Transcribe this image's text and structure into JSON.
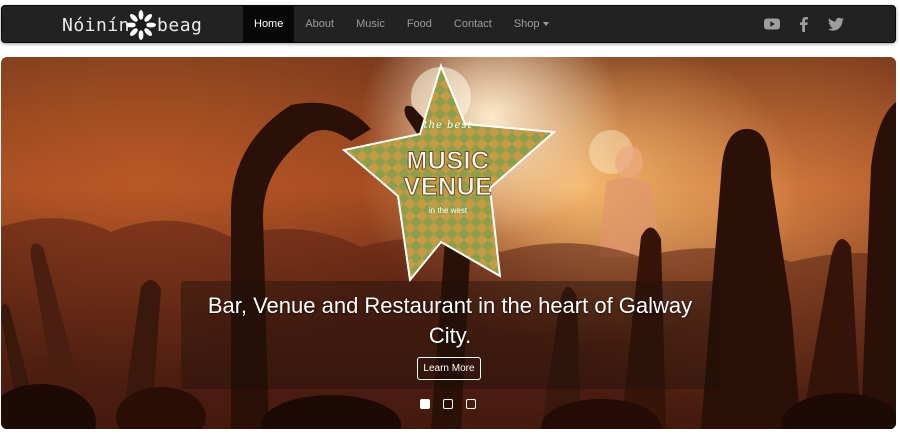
{
  "navbar": {
    "brand_first": "Nóinín",
    "brand_second": "beag",
    "items": [
      {
        "label": "Home",
        "active": true
      },
      {
        "label": "About",
        "active": false
      },
      {
        "label": "Music",
        "active": false
      },
      {
        "label": "Food",
        "active": false
      },
      {
        "label": "Contact",
        "active": false
      },
      {
        "label": "Shop",
        "active": false,
        "dropdown": true
      }
    ],
    "social": [
      "youtube-icon",
      "facebook-icon",
      "twitter-icon"
    ],
    "colors": {
      "bar": "#222222",
      "active_bg": "#080808",
      "link": "#9d9d9d",
      "active_link": "#ffffff"
    }
  },
  "carousel": {
    "badge": {
      "the_best": "the best",
      "music": "MUSIC",
      "venue": "VENUE",
      "in_the_west": "in the west",
      "colors": {
        "star_fill": "#c99a44",
        "diamond": "#8aa04a",
        "outline": "#ffffff"
      }
    },
    "caption": "Bar, Venue and Restaurant in the heart of Galway City.",
    "button_label": "Learn More",
    "slide_count": 3,
    "active_slide": 1
  }
}
